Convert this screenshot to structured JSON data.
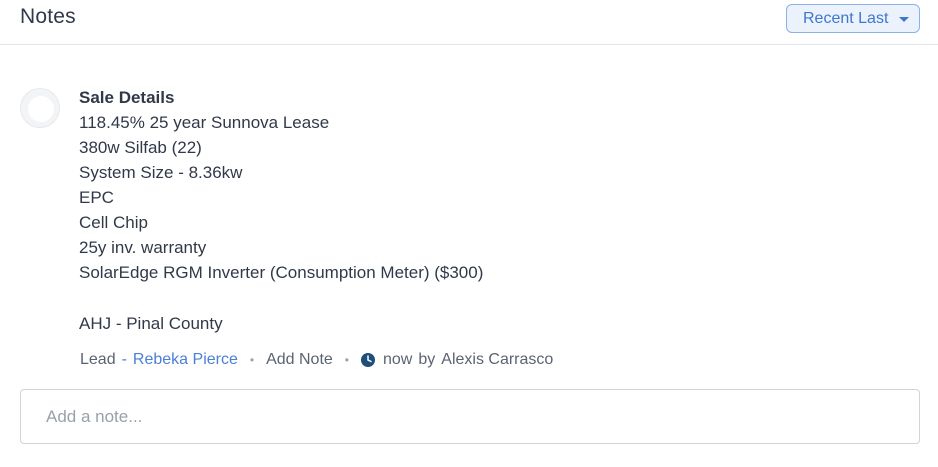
{
  "header": {
    "title": "Notes",
    "sort_label": "Recent Last"
  },
  "note": {
    "heading": "Sale Details",
    "lines": [
      "118.45% 25 year Sunnova Lease",
      "380w Silfab (22)",
      "System Size - 8.36kw",
      "EPC",
      "Cell Chip",
      "25y inv. warranty",
      "SolarEdge RGM Inverter (Consumption Meter) ($300)",
      "AHJ - Pinal County"
    ],
    "meta": {
      "module": "Lead",
      "dash": "-",
      "record": "Rebeka Pierce",
      "add_note": "Add Note",
      "time": "now",
      "by": "by",
      "author": "Alexis Carrasco"
    }
  },
  "composer": {
    "placeholder": "Add a note..."
  },
  "colors": {
    "accent": "#3d77d1",
    "link": "#4a80d6",
    "text": "#313949",
    "clock": "#1f4e79"
  }
}
